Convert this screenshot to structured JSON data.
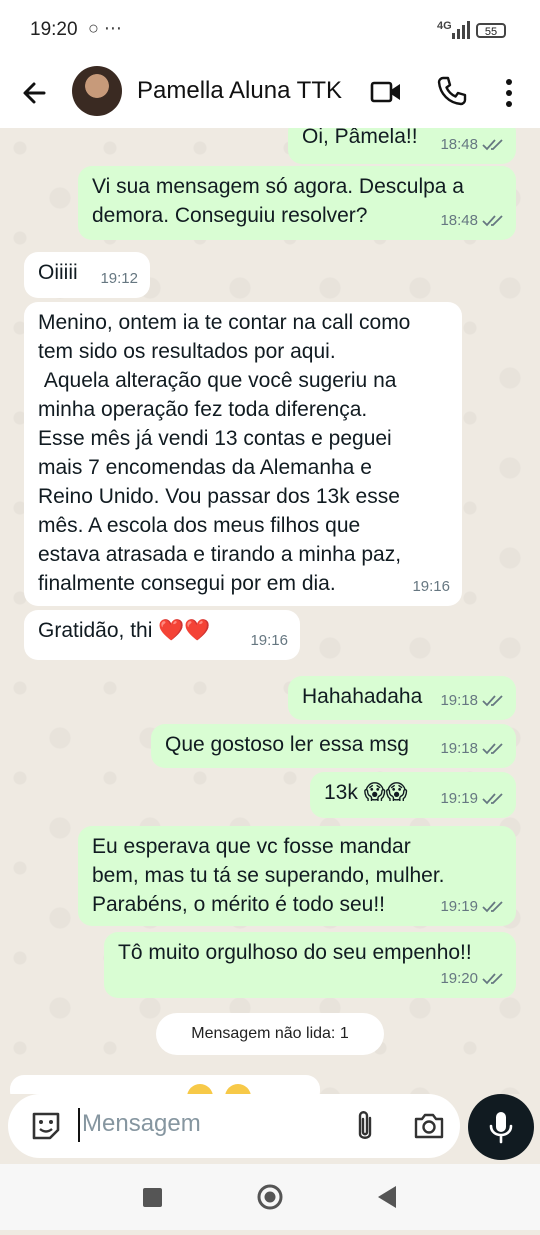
{
  "status_bar": {
    "time": "19:20",
    "icons": "○ ⋯",
    "network": "4G",
    "battery": "55"
  },
  "header": {
    "contact_name": "Pamella Aluna TTK"
  },
  "messages": [
    {
      "dir": "out",
      "text": "Oi, Pâmela!!",
      "time": "18:48"
    },
    {
      "dir": "out",
      "text": "Vi sua mensagem só agora. Desculpa a\ndemora. Conseguiu resolver?",
      "time": "18:48"
    },
    {
      "dir": "in",
      "text": "Oiiiii",
      "time": "19:12"
    },
    {
      "dir": "in",
      "text": "Menino, ontem ia te contar na call como\ntem sido os resultados por aqui.\n Aquela alteração que você sugeriu na\nminha operação fez toda diferença.\nEsse mês já vendi 13 contas e peguei\nmais 7 encomendas da Alemanha e\nReino Unido. Vou passar dos 13k esse\nmês. A escola dos meus filhos que\nestava atrasada e tirando a minha paz,\nfinalmente consegui por em dia.",
      "time": "19:16"
    },
    {
      "dir": "in",
      "text": "Gratidão, thi ❤️❤️",
      "time": "19:16"
    },
    {
      "dir": "out",
      "text": "Hahahadaha",
      "time": "19:18"
    },
    {
      "dir": "out",
      "text": "Que gostoso ler essa msg",
      "time": "19:18"
    },
    {
      "dir": "out",
      "text": "13k 😱😱",
      "time": "19:19"
    },
    {
      "dir": "out",
      "text": "Eu esperava que vc fosse mandar\nbem, mas tu tá se superando, mulher.\nParabéns, o mérito é todo seu!!",
      "time": "19:19"
    },
    {
      "dir": "out",
      "text": "Tô muito orgulhoso do seu empenho!!",
      "time": "19:20"
    }
  ],
  "unread_divider": "Mensagem não lida: 1",
  "composer": {
    "placeholder": "Mensagem"
  },
  "colors": {
    "outgoing_bubble": "#d9fdd3",
    "incoming_bubble": "#ffffff",
    "chat_background": "#efeae2",
    "tick_color": "#667781"
  }
}
